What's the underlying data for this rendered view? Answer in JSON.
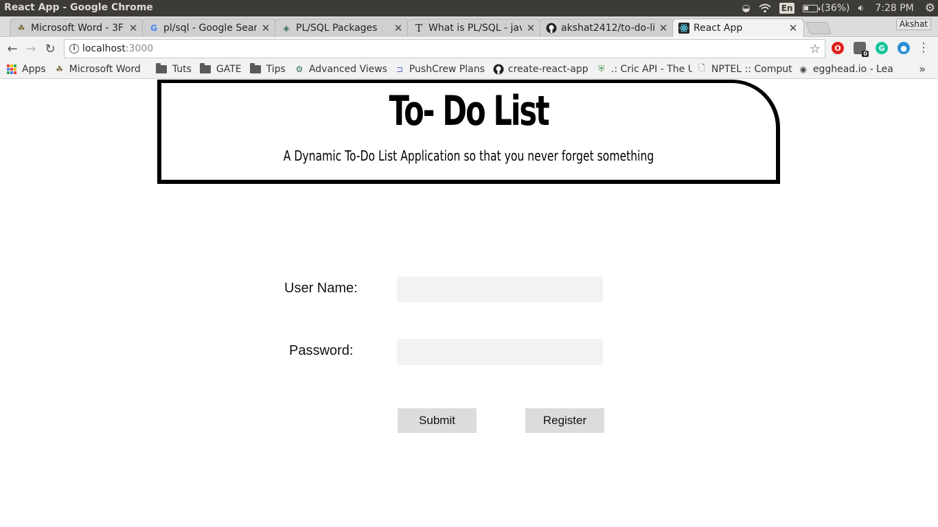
{
  "os_bar": {
    "window_title": "React App - Google Chrome",
    "lang": "En",
    "battery_text": "(36%)",
    "battery_level": 0.36,
    "time": "7:28 PM"
  },
  "tabs": [
    {
      "title": "Microsoft Word - 3F",
      "icon": "word-doc-icon",
      "active": false
    },
    {
      "title": "pl/sql - Google Sear",
      "icon": "google-icon",
      "active": false
    },
    {
      "title": "PL/SQL Packages",
      "icon": "diamond-icon",
      "active": false
    },
    {
      "title": "What is PL/SQL - jav",
      "icon": "t-letter-icon",
      "active": false
    },
    {
      "title": "akshat2412/to-do-li",
      "icon": "github-icon",
      "active": false
    },
    {
      "title": "React App",
      "icon": "react-icon",
      "active": true
    }
  ],
  "profile_name": "Akshat",
  "toolbar": {
    "url_host": "localhost",
    "url_port": ":3000",
    "ext_badge": "0"
  },
  "bookmarks": [
    {
      "label": "Apps",
      "icon": "apps-grid-icon"
    },
    {
      "label": "Microsoft Word",
      "icon": "word-doc-icon"
    },
    {
      "label": "Tuts",
      "icon": "folder-icon"
    },
    {
      "label": "GATE",
      "icon": "folder-icon"
    },
    {
      "label": "Tips",
      "icon": "folder-icon"
    },
    {
      "label": "Advanced Views",
      "icon": "views-icon"
    },
    {
      "label": "PushCrew Plans",
      "icon": "pushcrew-icon"
    },
    {
      "label": "create-react-app",
      "icon": "github-icon"
    },
    {
      "label": ".: Cric API - The U",
      "icon": "shield-icon"
    },
    {
      "label": "NPTEL :: Comput",
      "icon": "page-icon"
    },
    {
      "label": "egghead.io - Lea",
      "icon": "egghead-icon"
    }
  ],
  "bookmarks_more": "»",
  "app": {
    "title": "To- Do List",
    "subtitle": "A Dynamic To-Do List Application so that you never forget something"
  },
  "form": {
    "username_label": "User Name:",
    "username_value": "",
    "password_label": "Password:",
    "password_value": "",
    "submit_label": "Submit",
    "register_label": "Register"
  }
}
